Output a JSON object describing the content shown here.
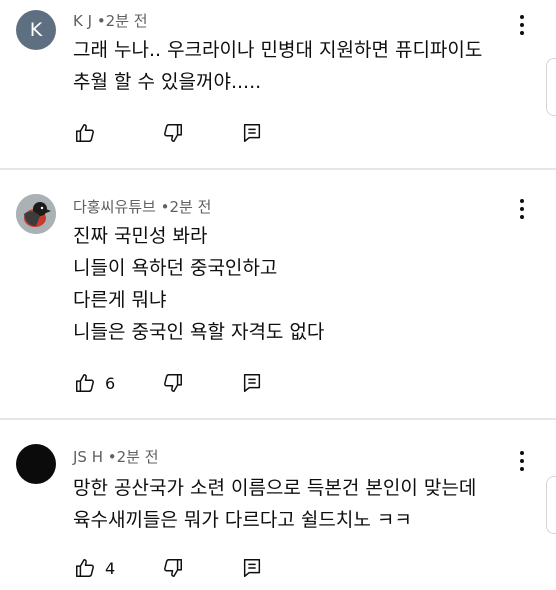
{
  "comments": [
    {
      "avatar_letter": "K",
      "avatar_color": "#5f6f82",
      "author": "K J",
      "separator": "•",
      "time": "2분 전",
      "lines": [
        "그래 누나.. 우크라이나 민병대 지원하면 퓨디파이도",
        "추월 할 수 있을꺼야....."
      ],
      "likes": ""
    },
    {
      "avatar_icon": "bird-avatar-icon",
      "author": "다홍씨유튜브",
      "separator": "•",
      "time": "2분 전",
      "lines": [
        "진짜 국민성 봐라",
        "니들이 욕하던 중국인하고",
        "다른게 뭐냐",
        "니들은 중국인 욕할 자격도 없다"
      ],
      "likes": "6"
    },
    {
      "avatar_color": "#0b0b0b",
      "author": "JS H",
      "separator": "•",
      "time": "2분 전",
      "lines": [
        "망한 공산국가 소련 이름으로 득본건 본인이 맞는데",
        "육수새끼들은 뭐가 다르다고 쉴드치노 ㅋㅋ"
      ],
      "likes": "4"
    }
  ],
  "icons": {
    "like": "thumb-up-icon",
    "dislike": "thumb-down-icon",
    "reply": "reply-icon",
    "menu": "more-vert-icon"
  },
  "colors": {
    "text": "#0f0f0f",
    "meta": "#606060",
    "divider": "#e6e6e6"
  }
}
